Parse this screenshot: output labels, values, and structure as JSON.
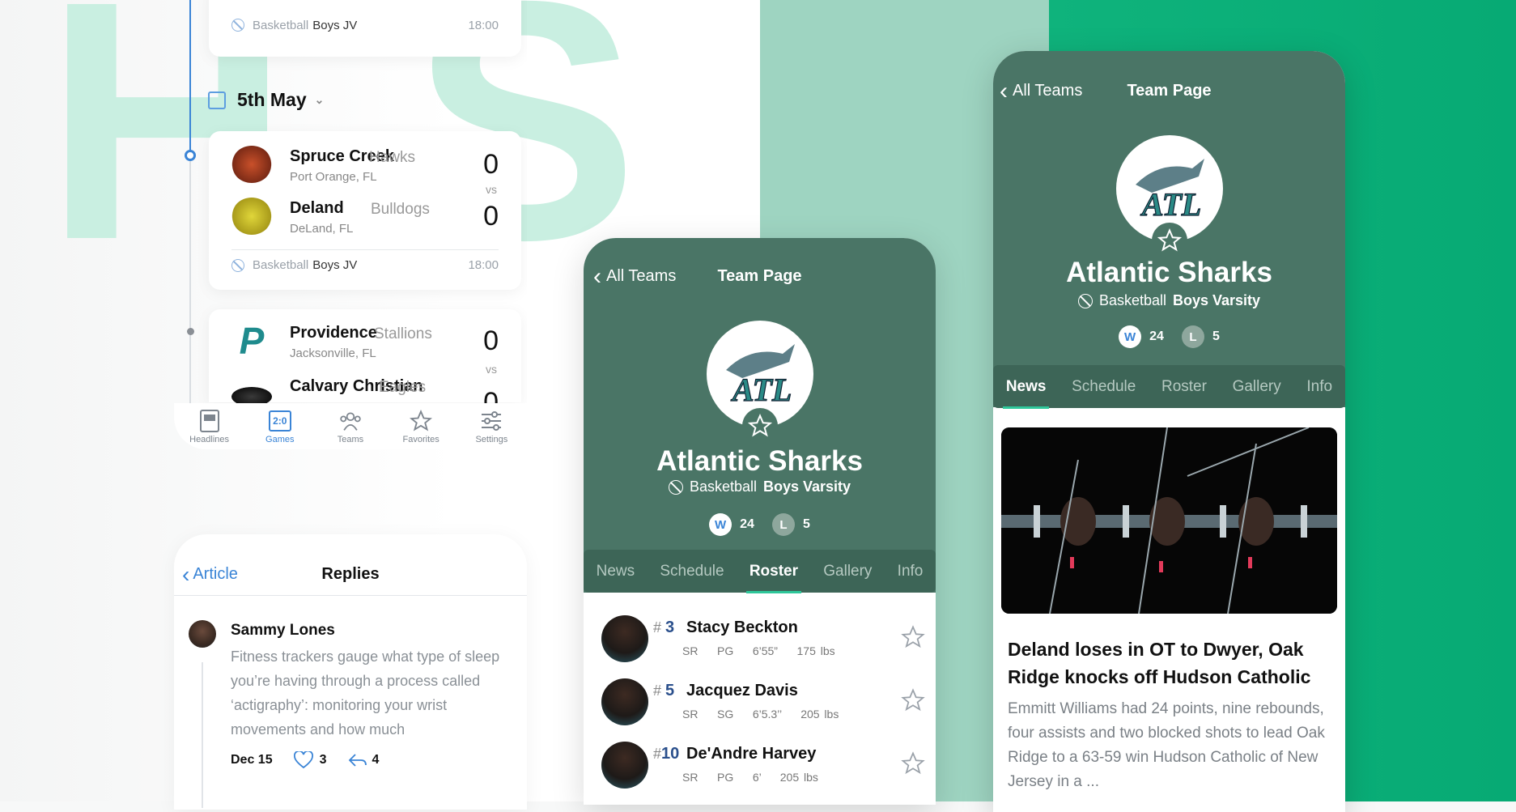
{
  "background": {
    "letters": "HS",
    "colors": {
      "left": "#ffffff",
      "mid": "#9ed4c1",
      "right": "#0fb37c"
    }
  },
  "schedule": {
    "top_game": {
      "sport": "Basketball",
      "level": "Boys JV",
      "time": "18:00"
    },
    "date": "5th May",
    "games": [
      {
        "home": {
          "name": "Spruce Creek",
          "mascot": "Hawks",
          "location": "Port Orange, FL",
          "score": "0"
        },
        "away": {
          "name": "Deland",
          "mascot": "Bulldogs",
          "location": "DeLand, FL",
          "score": "0"
        },
        "vs": "vs",
        "sport": "Basketball",
        "level": "Boys JV",
        "time": "18:00"
      },
      {
        "home": {
          "name": "Providence",
          "mascot": "Stallions",
          "location": "Jacksonville, FL",
          "score": "0"
        },
        "away": {
          "name": "Calvary Christian",
          "mascot": "Eagles",
          "location": "",
          "score": "0"
        },
        "vs": "vs"
      }
    ],
    "tabbar": [
      {
        "label": "Headlines",
        "icon": "headlines-icon"
      },
      {
        "label": "Games",
        "icon": "games-icon",
        "value": "2:0"
      },
      {
        "label": "Teams",
        "icon": "teams-icon"
      },
      {
        "label": "Favorites",
        "icon": "star-icon"
      },
      {
        "label": "Settings",
        "icon": "settings-icon"
      }
    ]
  },
  "replies": {
    "back": "Article",
    "title": "Replies",
    "comment": {
      "author": "Sammy Lones",
      "text": "Fitness trackers gauge what type of sleep you’re having through a process called ‘actigraphy’: monitoring your wrist movements and how much",
      "date": "Dec 15",
      "likes": "3",
      "replies": "4"
    }
  },
  "team_page": {
    "back": "All Teams",
    "title": "Team Page",
    "crest_text": "ATL",
    "team_name": "Atlantic Sharks",
    "sport": "Basketball",
    "level": "Boys Varsity",
    "wins_label": "W",
    "wins": "24",
    "losses_label": "L",
    "losses": "5",
    "tabs": [
      "News",
      "Schedule",
      "Roster",
      "Gallery",
      "Info"
    ],
    "roster": [
      {
        "number": "3",
        "name": "Stacy Beckton",
        "year": "SR",
        "pos": "PG",
        "height": "6’55”",
        "weight": "175 lbs"
      },
      {
        "number": "5",
        "name": "Jacquez Davis",
        "year": "SR",
        "pos": "SG",
        "height": "6’5.3’’",
        "weight": "205 lbs"
      },
      {
        "number": "10",
        "name": "De'Andre Harvey",
        "year": "SR",
        "pos": "PG",
        "height": "6’",
        "weight": "205 lbs"
      }
    ],
    "article": {
      "headline": "Deland loses in OT to Dwyer, Oak Ridge knocks off Hudson Catholic",
      "summary": "Emmitt Williams had 24 points, nine rebounds, four assists and two blocked shots to lead Oak Ridge to a 63-59 win Hudson Catholic of New Jersey in a ..."
    }
  },
  "colors": {
    "team_green": "#4a7566",
    "accent_blue": "#3a84d6",
    "tab_underline": "#2ec79a"
  }
}
